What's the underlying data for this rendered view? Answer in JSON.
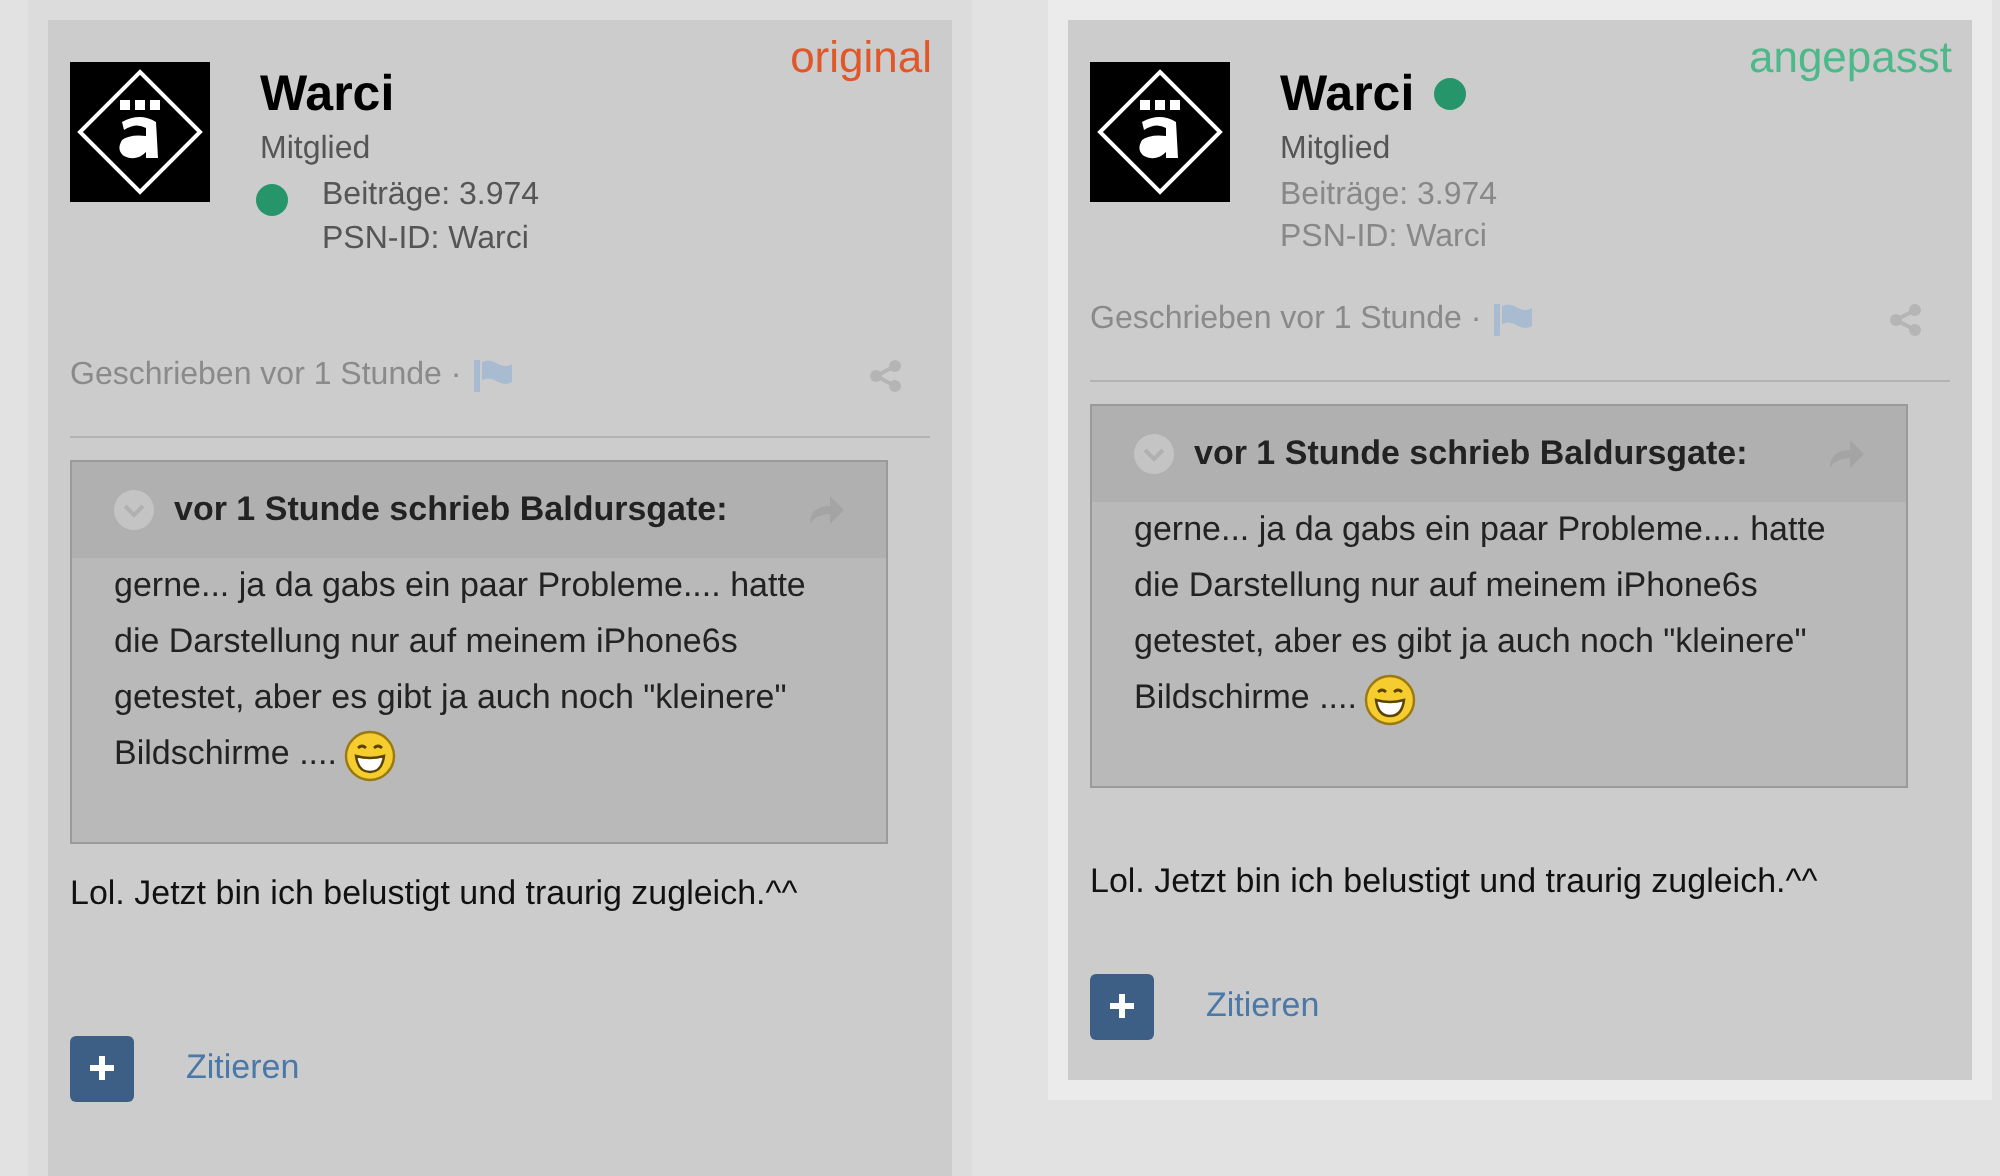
{
  "panels": [
    {
      "kind": "dot-by-stats",
      "label": "original",
      "color": "#e0582a",
      "username": "Warci",
      "role": "Mitglied",
      "posts": "Beiträge: 3.974",
      "psn": "PSN-ID: Warci",
      "posted": "Geschrieben vor 1 Stunde ·",
      "quote": {
        "header": "vor 1 Stunde schrieb Baldursgate:",
        "text": "gerne... ja da gabs ein paar Probleme.... hatte die Darstellung nur auf meinem iPhone6s getestet, aber es gibt ja auch noch \"kleinere\" Bildschirme ...."
      },
      "reply": "Lol. Jetzt bin ich belustigt und traurig zugleich.^^",
      "quote_button": "Zitieren"
    },
    {
      "kind": "dot-by-name",
      "label": "angepasst",
      "color": "#4db88a",
      "username": "Warci",
      "role": "Mitglied",
      "posts": "Beiträge: 3.974",
      "psn": "PSN-ID: Warci",
      "posted": "Geschrieben vor 1 Stunde ·",
      "quote": {
        "header": "vor 1 Stunde schrieb Baldursgate:",
        "text": "gerne... ja da gabs ein paar Probleme.... hatte die Darstellung nur auf meinem iPhone6s getestet, aber es gibt ja auch noch \"kleinere\" Bildschirme ...."
      },
      "reply": "Lol. Jetzt bin ich belustigt und traurig zugleich.^^",
      "quote_button": "Zitieren"
    }
  ]
}
